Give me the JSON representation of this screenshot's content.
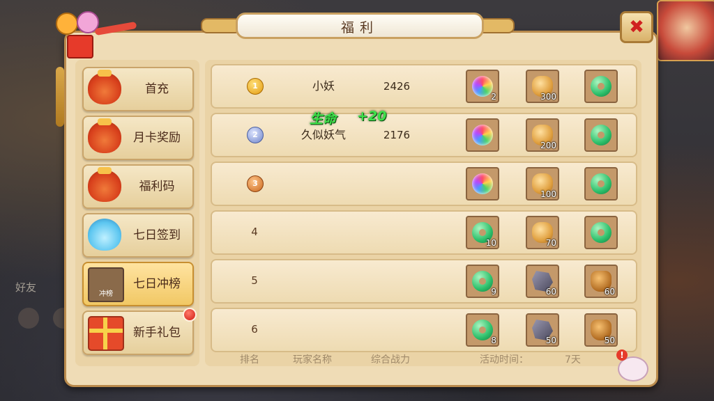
{
  "title": "福利",
  "sidebar": {
    "items": [
      {
        "label": "首充",
        "icon": "red-money-bag-icon",
        "active": false
      },
      {
        "label": "月卡奖励",
        "icon": "red-money-bag-icon",
        "active": false
      },
      {
        "label": "福利码",
        "icon": "red-money-bag-icon",
        "active": false
      },
      {
        "label": "七日签到",
        "icon": "blue-money-bag-icon",
        "active": false
      },
      {
        "label": "七日冲榜",
        "icon": "ranking-chest-icon",
        "icon_text": "冲榜",
        "active": true
      },
      {
        "label": "新手礼包",
        "icon": "gift-box-icon",
        "active": false,
        "badge": true
      }
    ]
  },
  "rows": [
    {
      "rank": "1",
      "medal": "gold",
      "name": "小妖",
      "power": "2426",
      "rewards": [
        {
          "icon": "rainbow-orb-icon",
          "qty": "2"
        },
        {
          "icon": "gold-ingot-icon",
          "qty": "300"
        },
        {
          "icon": "jade-ring-icon",
          "qty": ""
        }
      ]
    },
    {
      "rank": "2",
      "medal": "silver",
      "name": "久似妖气",
      "power": "2176",
      "rewards": [
        {
          "icon": "rainbow-orb-icon",
          "qty": ""
        },
        {
          "icon": "gold-ingot-icon",
          "qty": "200"
        },
        {
          "icon": "jade-ring-icon",
          "qty": ""
        }
      ]
    },
    {
      "rank": "3",
      "medal": "bronze",
      "name": "",
      "power": "",
      "rewards": [
        {
          "icon": "rainbow-orb-icon",
          "qty": ""
        },
        {
          "icon": "gold-ingot-icon",
          "qty": "100"
        },
        {
          "icon": "jade-ring-icon",
          "qty": ""
        }
      ]
    },
    {
      "rank": "4",
      "medal": "",
      "name": "",
      "power": "",
      "rewards": [
        {
          "icon": "jade-ring-icon",
          "qty": "10"
        },
        {
          "icon": "gold-ingot-icon",
          "qty": "70"
        },
        {
          "icon": "jade-ring-icon",
          "qty": ""
        }
      ]
    },
    {
      "rank": "5",
      "medal": "",
      "name": "",
      "power": "",
      "rewards": [
        {
          "icon": "jade-ring-icon",
          "qty": "9"
        },
        {
          "icon": "stone-icon",
          "qty": "60"
        },
        {
          "icon": "clay-pot-icon",
          "qty": "60"
        }
      ]
    },
    {
      "rank": "6",
      "medal": "",
      "name": "",
      "power": "",
      "rewards": [
        {
          "icon": "jade-ring-icon",
          "qty": "8"
        },
        {
          "icon": "stone-icon",
          "qty": "50"
        },
        {
          "icon": "clay-pot-icon",
          "qty": "50"
        }
      ]
    }
  ],
  "float_text": {
    "label": "生命",
    "value": "+20"
  },
  "footer": {
    "rank_header": "排名",
    "name_header": "玩家名称",
    "power_header": "综合战力",
    "time_label": "活动时间：",
    "time_value": "7天"
  },
  "background": {
    "friend_label": "好友"
  },
  "close_icon": "close-icon",
  "colors": {
    "panel": "#efdcb6",
    "border": "#b98a4c",
    "close_x": "#d02020",
    "float_text": "#3ee04a"
  }
}
